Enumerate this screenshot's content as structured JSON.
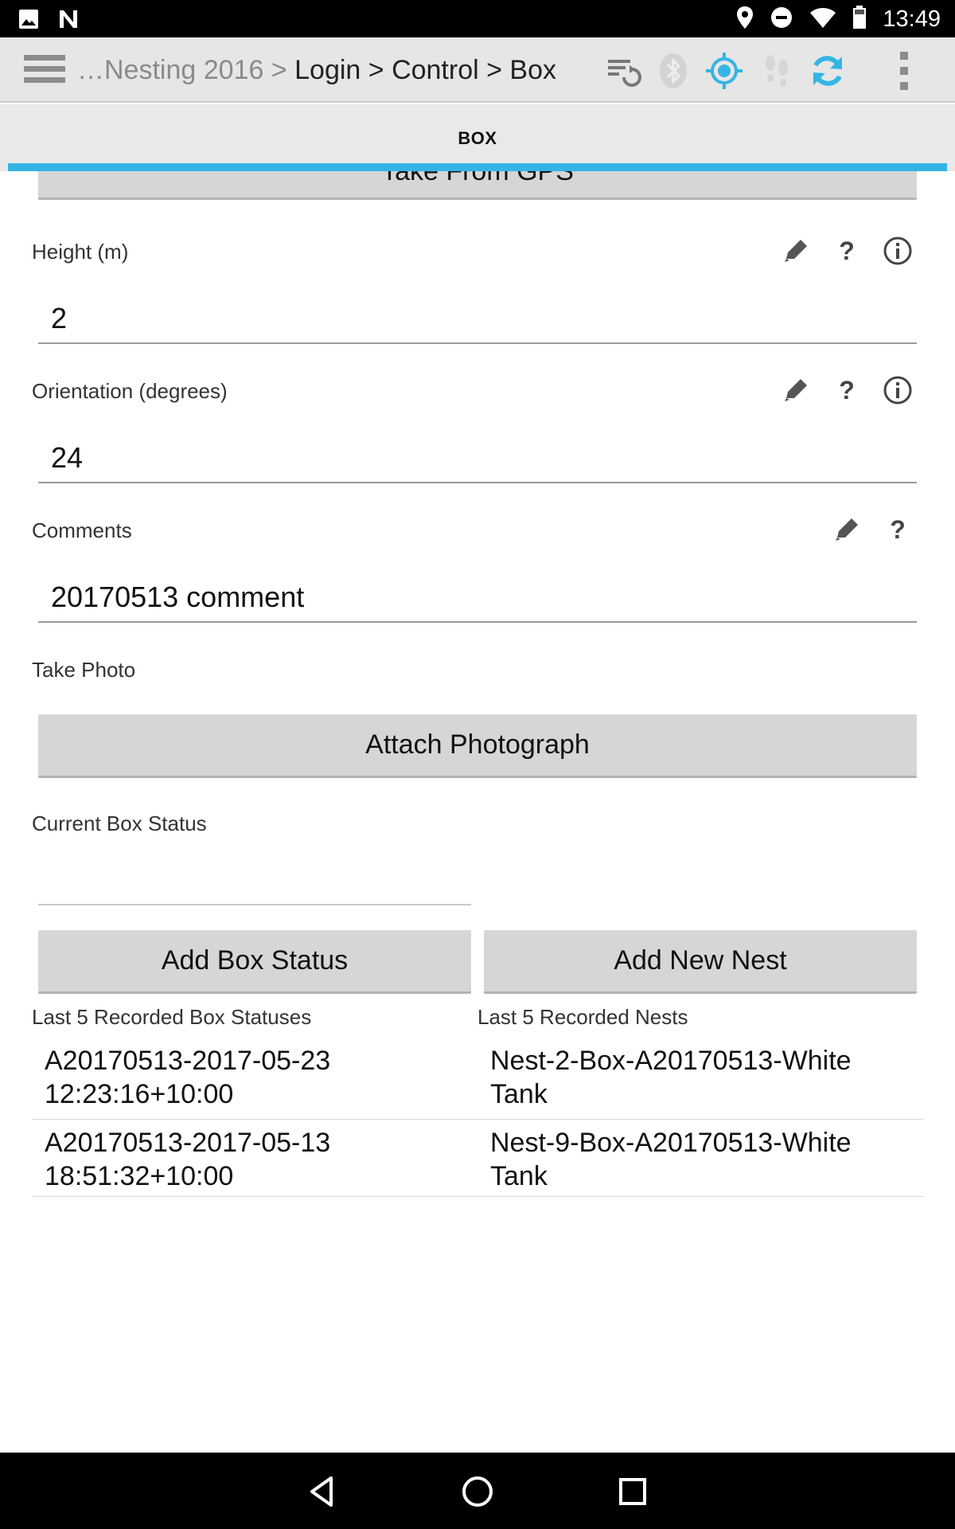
{
  "status_bar": {
    "time": "13:49",
    "left_icons": [
      "image-icon",
      "n-logo-icon"
    ],
    "right_icons": [
      "location-pin-icon",
      "do-not-disturb-icon",
      "wifi-icon",
      "battery-icon"
    ]
  },
  "toolbar": {
    "breadcrumb_faded": "…Nesting 2016 > ",
    "breadcrumb_path": "Login > Control > Box",
    "icons": [
      "sync-list-icon",
      "bluetooth-icon",
      "gps-target-icon",
      "footsteps-icon",
      "refresh-icon",
      "overflow-menu-icon"
    ]
  },
  "tab": {
    "label": "BOX"
  },
  "form": {
    "gps_button": "Take From GPS",
    "height": {
      "label": "Height (m)",
      "value": "2"
    },
    "orientation": {
      "label": "Orientation (degrees)",
      "value": "24"
    },
    "comments": {
      "label": "Comments",
      "value": "20170513 comment"
    },
    "photo": {
      "label": "Take Photo",
      "button": "Attach Photograph"
    },
    "box_status": {
      "label": "Current Box Status",
      "value": ""
    },
    "add_box_status_button": "Add Box Status",
    "add_new_nest_button": "Add New Nest"
  },
  "lists": {
    "box_statuses": {
      "title": "Last 5 Recorded Box Statuses",
      "items": [
        {
          "line1": "A20170513-2017-05-23",
          "line2": "12:23:16+10:00"
        },
        {
          "line1": "A20170513-2017-05-13",
          "line2": "18:51:32+10:00"
        }
      ]
    },
    "nests": {
      "title": "Last 5 Recorded Nests",
      "items": [
        {
          "line1": "Nest-2-Box-A20170513-White",
          "line2": "Tank"
        },
        {
          "line1": "Nest-9-Box-A20170513-White",
          "line2": "Tank"
        }
      ]
    }
  },
  "colors": {
    "accent": "#33b5e5",
    "toolbar_bg": "#e6e6e6",
    "button_bg": "#d6d6d6"
  }
}
